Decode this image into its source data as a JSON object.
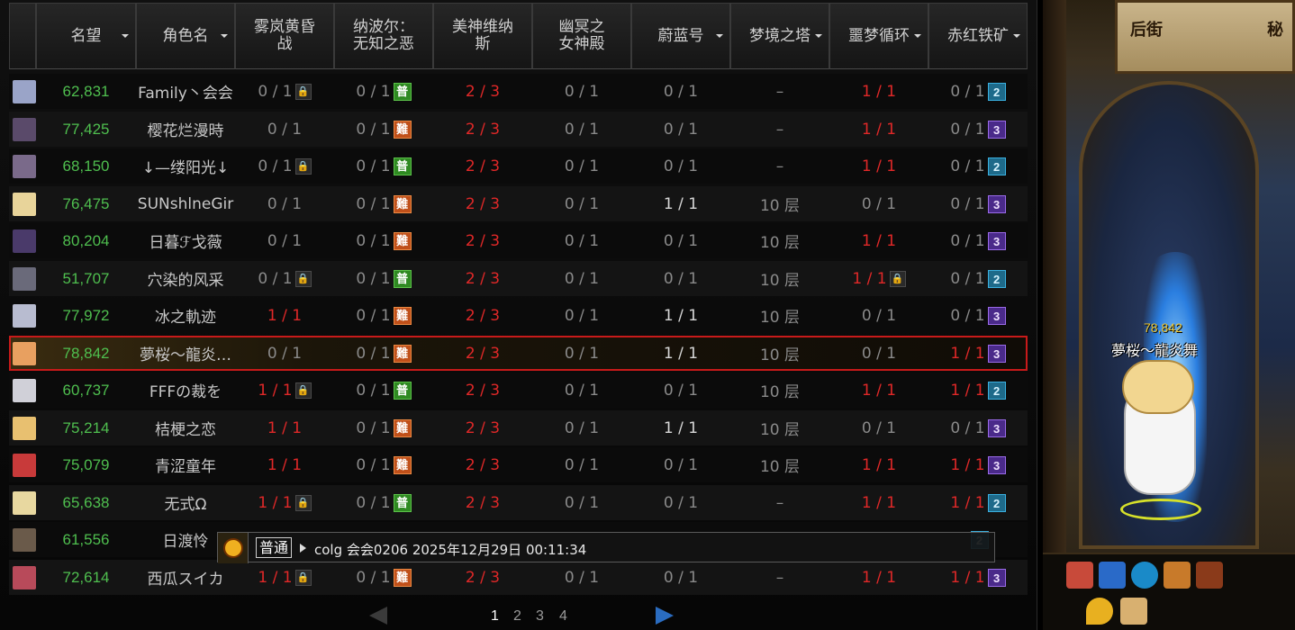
{
  "table": {
    "columns": [
      {
        "label": "名望",
        "sortable": true
      },
      {
        "label": "角色名",
        "sortable": true
      },
      {
        "label": "雾岚黄昏\n战",
        "sortable": false
      },
      {
        "label": "纳波尔：\n无知之恶",
        "sortable": false
      },
      {
        "label": "美神维纳\n斯",
        "sortable": false
      },
      {
        "label": "幽冥之\n女神殿",
        "sortable": false
      },
      {
        "label": "蔚蓝号",
        "sortable": true
      },
      {
        "label": "梦境之塔",
        "sortable": true
      },
      {
        "label": "噩梦循环",
        "sortable": true
      },
      {
        "label": "赤红铁矿",
        "sortable": true
      }
    ],
    "rows": [
      {
        "avatar": "#9aa4c8",
        "fame": "62,831",
        "name": "Family丶会会",
        "wu": "0 / 1",
        "wu_lock": true,
        "na": "0 / 1",
        "na_badge": "普",
        "na_tone": "green",
        "mei": "2 / 3",
        "you": "0 / 1",
        "wei": "0 / 1",
        "meng": "–",
        "e": "1 / 1",
        "e_lock": false,
        "chi": "0 / 1",
        "chi_badge": "2",
        "chi_tone": "blue"
      },
      {
        "avatar": "#5a4a6a",
        "fame": "77,425",
        "name": "樱花烂漫時",
        "wu": "0 / 1",
        "wu_lock": false,
        "na": "0 / 1",
        "na_badge": "難",
        "na_tone": "orange",
        "mei": "2 / 3",
        "you": "0 / 1",
        "wei": "0 / 1",
        "meng": "–",
        "e": "1 / 1",
        "e_lock": false,
        "chi": "0 / 1",
        "chi_badge": "3",
        "chi_tone": "purple"
      },
      {
        "avatar": "#7a6a8a",
        "fame": "68,150",
        "name": "↓—缕阳光↓",
        "wu": "0 / 1",
        "wu_lock": true,
        "na": "0 / 1",
        "na_badge": "普",
        "na_tone": "green",
        "mei": "2 / 3",
        "you": "0 / 1",
        "wei": "0 / 1",
        "meng": "–",
        "e": "1 / 1",
        "e_lock": false,
        "chi": "0 / 1",
        "chi_badge": "2",
        "chi_tone": "blue"
      },
      {
        "avatar": "#e8d49a",
        "fame": "76,475",
        "name": "SUNshlneGir",
        "wu": "0 / 1",
        "wu_lock": false,
        "na": "0 / 1",
        "na_badge": "難",
        "na_tone": "orange",
        "mei": "2 / 3",
        "you": "0 / 1",
        "wei": "1 / 1",
        "meng": "10 层",
        "e": "0 / 1",
        "e_lock": false,
        "chi": "0 / 1",
        "chi_badge": "3",
        "chi_tone": "purple"
      },
      {
        "avatar": "#4a3a6a",
        "fame": "80,204",
        "name": "日暮ℱ戈薇",
        "wu": "0 / 1",
        "wu_lock": false,
        "na": "0 / 1",
        "na_badge": "難",
        "na_tone": "orange",
        "mei": "2 / 3",
        "you": "0 / 1",
        "wei": "0 / 1",
        "meng": "10 层",
        "e": "1 / 1",
        "e_lock": false,
        "chi": "0 / 1",
        "chi_badge": "3",
        "chi_tone": "purple"
      },
      {
        "avatar": "#6a6a7a",
        "fame": "51,707",
        "name": "穴染的风采",
        "wu": "0 / 1",
        "wu_lock": true,
        "na": "0 / 1",
        "na_badge": "普",
        "na_tone": "green",
        "mei": "2 / 3",
        "you": "0 / 1",
        "wei": "0 / 1",
        "meng": "10 层",
        "e": "1 / 1",
        "e_lock": true,
        "chi": "0 / 1",
        "chi_badge": "2",
        "chi_tone": "blue"
      },
      {
        "avatar": "#b8bcd0",
        "fame": "77,972",
        "name": "冰之軌迹",
        "wu": "1 / 1",
        "wu_lock": false,
        "na": "0 / 1",
        "na_badge": "難",
        "na_tone": "orange",
        "mei": "2 / 3",
        "you": "0 / 1",
        "wei": "1 / 1",
        "meng": "10 层",
        "e": "0 / 1",
        "e_lock": false,
        "chi": "0 / 1",
        "chi_badge": "3",
        "chi_tone": "purple"
      },
      {
        "avatar": "#e8a060",
        "fame": "78,842",
        "name": "夢桜～龍炎…",
        "wu": "0 / 1",
        "wu_lock": false,
        "na": "0 / 1",
        "na_badge": "難",
        "na_tone": "orange",
        "mei": "2 / 3",
        "you": "0 / 1",
        "wei": "1 / 1",
        "meng": "10 层",
        "e": "0 / 1",
        "e_lock": false,
        "chi": "1 / 1",
        "chi_badge": "3",
        "chi_tone": "purple",
        "selected": true
      },
      {
        "avatar": "#d0d0d8",
        "fame": "60,737",
        "name": "FFFの裁を",
        "wu": "1 / 1",
        "wu_lock": true,
        "na": "0 / 1",
        "na_badge": "普",
        "na_tone": "green",
        "mei": "2 / 3",
        "you": "0 / 1",
        "wei": "0 / 1",
        "meng": "10 层",
        "e": "1 / 1",
        "e_lock": false,
        "chi": "1 / 1",
        "chi_badge": "2",
        "chi_tone": "blue"
      },
      {
        "avatar": "#e8c070",
        "fame": "75,214",
        "name": "桔梗之恋",
        "wu": "1 / 1",
        "wu_lock": false,
        "na": "0 / 1",
        "na_badge": "難",
        "na_tone": "orange",
        "mei": "2 / 3",
        "you": "0 / 1",
        "wei": "1 / 1",
        "meng": "10 层",
        "e": "0 / 1",
        "e_lock": false,
        "chi": "0 / 1",
        "chi_badge": "3",
        "chi_tone": "purple"
      },
      {
        "avatar": "#c83a3a",
        "fame": "75,079",
        "name": "青涩童年",
        "wu": "1 / 1",
        "wu_lock": false,
        "na": "0 / 1",
        "na_badge": "難",
        "na_tone": "orange",
        "mei": "2 / 3",
        "you": "0 / 1",
        "wei": "0 / 1",
        "meng": "10 层",
        "e": "1 / 1",
        "e_lock": false,
        "chi": "1 / 1",
        "chi_badge": "3",
        "chi_tone": "purple"
      },
      {
        "avatar": "#e8d8a0",
        "fame": "65,638",
        "name": "无式Ω",
        "wu": "1 / 1",
        "wu_lock": true,
        "na": "0 / 1",
        "na_badge": "普",
        "na_tone": "green",
        "mei": "2 / 3",
        "you": "0 / 1",
        "wei": "0 / 1",
        "meng": "–",
        "e": "1 / 1",
        "e_lock": false,
        "chi": "1 / 1",
        "chi_badge": "2",
        "chi_tone": "blue"
      },
      {
        "avatar": "#6a5a4a",
        "fame": "61,556",
        "name": "日渡怜",
        "chi_badge": "2",
        "chi_tone": "blue",
        "partial": true
      },
      {
        "avatar": "#b84a5a",
        "fame": "72,614",
        "name": "西瓜スイカ",
        "wu": "1 / 1",
        "wu_lock": true,
        "na": "0 / 1",
        "na_badge": "難",
        "na_tone": "orange",
        "mei": "2 / 3",
        "you": "0 / 1",
        "wei": "0 / 1",
        "meng": "–",
        "e": "1 / 1",
        "e_lock": false,
        "chi": "1 / 1",
        "chi_badge": "3",
        "chi_tone": "purple"
      }
    ]
  },
  "chat": {
    "tag": "普通",
    "text": "colg 会会0206  2025年12月29日 00:11:34"
  },
  "pager": {
    "pages": [
      "1",
      "2",
      "3",
      "4"
    ],
    "current": "1"
  },
  "scene": {
    "sign_left": "后街",
    "sign_right": "秘",
    "character_fame": "78,842",
    "character_name": "夢桜～龍炎舞"
  }
}
